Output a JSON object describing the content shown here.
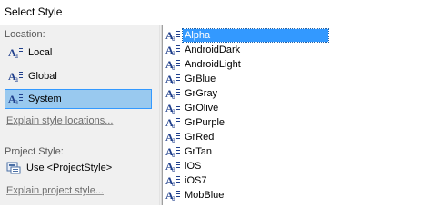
{
  "window": {
    "title": "Select Style"
  },
  "location": {
    "label": "Location:",
    "items": [
      {
        "label": "Local",
        "icon": "text-style-icon",
        "selected": false
      },
      {
        "label": "Global",
        "icon": "text-style-icon",
        "selected": false
      },
      {
        "label": "System",
        "icon": "text-style-icon",
        "selected": true
      }
    ],
    "explain_link": "Explain style locations..."
  },
  "project_style": {
    "label": "Project Style:",
    "item": {
      "label": "Use <ProjectStyle>",
      "icon": "project-style-icon"
    },
    "explain_link": "Explain project style..."
  },
  "styles": {
    "items": [
      "Alpha",
      "AndroidDark",
      "AndroidLight",
      "GrBlue",
      "GrGray",
      "GrOlive",
      "GrPurple",
      "GrRed",
      "GrTan",
      "iOS",
      "iOS7",
      "MobBlue"
    ],
    "selected": "Alpha"
  },
  "colors": {
    "selection": "#3399ff",
    "location_selection": "#99c9ef",
    "left_pane_bg": "#f0f0f0"
  }
}
